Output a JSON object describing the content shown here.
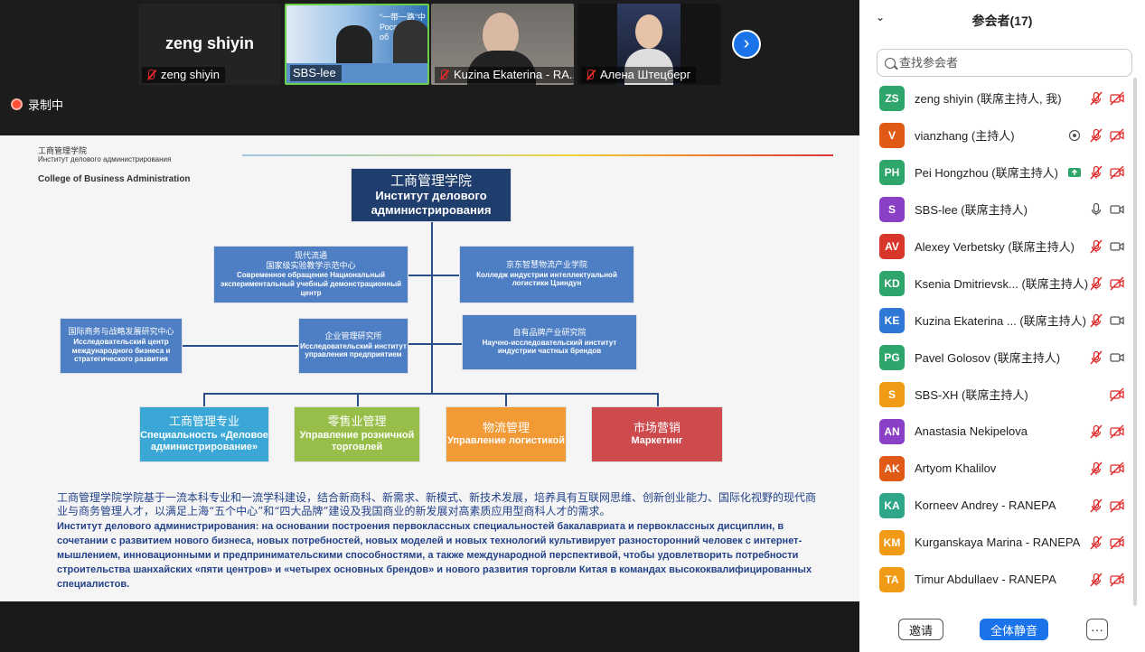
{
  "videos": [
    {
      "name": "zeng shiyin",
      "big_name": "zeng shiyin"
    },
    {
      "name": "SBS-lee",
      "banner": "“一带一路”中\nРоссийско-к\nоб"
    },
    {
      "name": "Kuzina Ekaterina  - RA..."
    },
    {
      "name": "Алена Штецберг"
    }
  ],
  "recording_label": "录制中",
  "slide": {
    "header_cn": "工商管理学院",
    "header_ru": "Институт делового администрирования",
    "header_en": "College of Business Administration",
    "top_box": {
      "cn": "工商管理学院",
      "ru": "Институт делового администрирования"
    },
    "box1": {
      "cn": "现代流通\n国家级实验教学示范中心",
      "ru": "Современное обращение\nНациональный экспериментальный учебный демонстрационный центр"
    },
    "box2": {
      "cn": "京东智慧物流产业学院",
      "ru": "Колледж индустрии интеллектуальной логистики Цзиндун"
    },
    "box3": {
      "cn": "国际商务与战略发展研究中心",
      "ru": "Исследовательский центр международного бизнеса и стратегического развития"
    },
    "box4": {
      "cn": "企业管理研究所",
      "ru": "Исследовательский институт управления предприятием"
    },
    "box5": {
      "cn": "自有品牌产业研究院",
      "ru": "Научно-исследовательский институт индустрии частных брендов"
    },
    "c1": {
      "cn": "工商管理专业",
      "ru": "Специальность «Деловое администрирование»"
    },
    "c2": {
      "cn": "零售业管理",
      "ru": "Управление розничной торговлей"
    },
    "c3": {
      "cn": "物流管理",
      "ru": "Управление логистикой"
    },
    "c4": {
      "cn": "市场营销",
      "ru": "Маркетинг"
    },
    "para_cn": "工商管理学院学院基于一流本科专业和一流学科建设，结合新商科、新需求、新模式、新技术发展，培养具有互联网思维、创新创业能力、国际化视野的现代商业与商务管理人才，以满足上海“五个中心”和“四大品牌”建设及我国商业的新发展对高素质应用型商科人才的需求。",
    "para_ru": "Институт делового администрирования: на основании построения первоклассных специальностей бакалавриата и первоклассных дисциплин, в сочетании с развитием нового бизнеса, новых потребностей, новых моделей и новых технологий культивирует разносторонний человек с интернет-мышлением, инновационными и предпринимательскими способностями, а также международной перспективой, чтобы удовлетворить потребности строительства шанхайских «пяти центров» и «четырех основных брендов» и нового развития торговли Китая в командах высококвалифицированных специалистов."
  },
  "panel": {
    "title": "参会者(17)",
    "search_placeholder": "查找参会者",
    "invite_label": "邀请",
    "mute_all_label": "全体静音",
    "more_label": "···",
    "participants": [
      {
        "initials": "ZS",
        "name": "zeng shiyin (联席主持人, 我)",
        "color": "#2ea66b",
        "mic": "off",
        "cam": "off"
      },
      {
        "initials": "V",
        "name": "vianzhang (主持人)",
        "color": "#e05a16",
        "mic": "off",
        "cam": "off",
        "extra": "record-dot-icon"
      },
      {
        "initials": "PH",
        "name": "Pei Hongzhou (联席主持人)",
        "color": "#2ea66b",
        "mic": "off",
        "cam": "off",
        "extra": "share-screen-icon"
      },
      {
        "initials": "S",
        "name": "SBS-lee (联席主持人)",
        "color": "#8a3fc7",
        "mic": "on",
        "cam": "on"
      },
      {
        "initials": "AV",
        "name": "Alexey Verbetsky (联席主持人)",
        "color": "#d9362b",
        "mic": "off",
        "cam": "on"
      },
      {
        "initials": "KD",
        "name": "Ksenia Dmitrievsk... (联席主持人)",
        "color": "#2ea66b",
        "mic": "off",
        "cam": "off"
      },
      {
        "initials": "KE",
        "name": "Kuzina Ekaterina  ... (联席主持人)",
        "color": "#2f78d6",
        "mic": "off",
        "cam": "on"
      },
      {
        "initials": "PG",
        "name": "Pavel Golosov (联席主持人)",
        "color": "#2ea66b",
        "mic": "off",
        "cam": "on"
      },
      {
        "initials": "S",
        "name": "SBS-XH (联席主持人)",
        "color": "#f09a16",
        "mic": "none",
        "cam": "off"
      },
      {
        "initials": "AN",
        "name": "Anastasia Nekipelova",
        "color": "#8a3fc7",
        "mic": "off",
        "cam": "off"
      },
      {
        "initials": "AK",
        "name": "Artyom Khalilov",
        "color": "#e05a16",
        "mic": "off",
        "cam": "off"
      },
      {
        "initials": "KA",
        "name": "Korneev Andrey - RANEPA",
        "color": "#2ea68a",
        "mic": "off",
        "cam": "off"
      },
      {
        "initials": "KM",
        "name": "Kurganskaya Marina - RANEPA",
        "color": "#f09a16",
        "mic": "off",
        "cam": "off"
      },
      {
        "initials": "TA",
        "name": "Timur Abdullaev - RANEPA",
        "color": "#f09a16",
        "mic": "off",
        "cam": "off"
      }
    ]
  }
}
